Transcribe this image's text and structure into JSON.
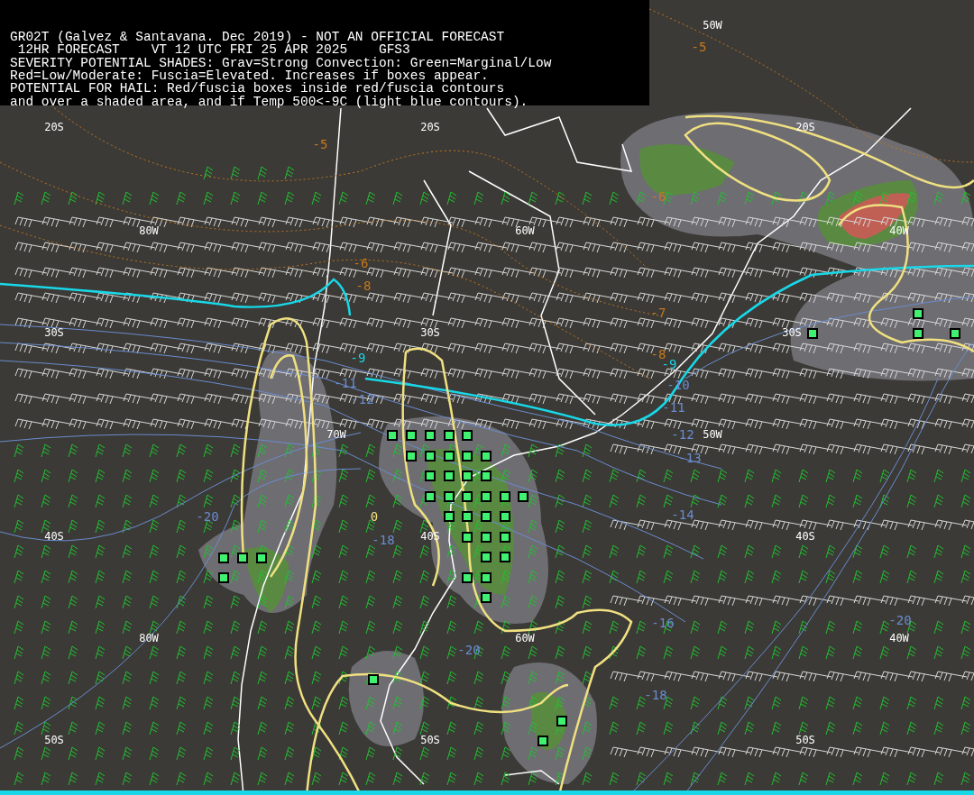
{
  "header": {
    "lines": [
      "GR02T (Galvez & Santavana. Dec 2019) - NOT AN OFFICIAL FORECAST",
      " 12HR FORECAST    VT 12 UTC FRI 25 APR 2025    GFS3",
      "SEVERITY POTENTIAL SHADES: Grav=Strong Convection: Green=Marginal/Low",
      "Red=Low/Moderate: Fuscia=Elevated. Increases if boxes appear.",
      "POTENTIAL FOR HAIL: Red/fuscia boxes inside red/fuscia contours",
      "and over a shaded area, and if Temp 500<-9C (light blue contours)."
    ]
  },
  "map": {
    "grid_labels": [
      "50W",
      "20S",
      "20S",
      "20S",
      "80W",
      "60W",
      "40W",
      "30S",
      "30S",
      "30S",
      "70W",
      "50W",
      "40S",
      "40S",
      "40S",
      "80W",
      "60W",
      "40W",
      "50S",
      "50S",
      "50S"
    ],
    "contour_labels": [
      {
        "text": "-5",
        "color": "#c8781e"
      },
      {
        "text": "-5",
        "color": "#c8781e"
      },
      {
        "text": "-6",
        "color": "#c8781e"
      },
      {
        "text": "-8",
        "color": "#c8781e"
      },
      {
        "text": "-6",
        "color": "#c8781e"
      },
      {
        "text": "-7",
        "color": "#c8781e"
      },
      {
        "text": "-8",
        "color": "#c8781e"
      },
      {
        "text": "-9",
        "color": "#18d8e8"
      },
      {
        "text": "-9",
        "color": "#18d8e8"
      },
      {
        "text": "-11",
        "color": "#6a8cd0"
      },
      {
        "text": "-12",
        "color": "#6a8cd0"
      },
      {
        "text": "-10",
        "color": "#6a8cd0"
      },
      {
        "text": "-11",
        "color": "#6a8cd0"
      },
      {
        "text": "-12",
        "color": "#6a8cd0"
      },
      {
        "text": "-13",
        "color": "#6a8cd0"
      },
      {
        "text": "-14",
        "color": "#6a8cd0"
      },
      {
        "text": "-16",
        "color": "#6a8cd0"
      },
      {
        "text": "-18",
        "color": "#6a8cd0"
      },
      {
        "text": "-20",
        "color": "#6a8cd0"
      },
      {
        "text": "-20",
        "color": "#6a8cd0"
      },
      {
        "text": "-18",
        "color": "#6a8cd0"
      },
      {
        "text": "-20",
        "color": "#6a8cd0"
      },
      {
        "text": "0",
        "color": "#f0e080"
      }
    ]
  }
}
